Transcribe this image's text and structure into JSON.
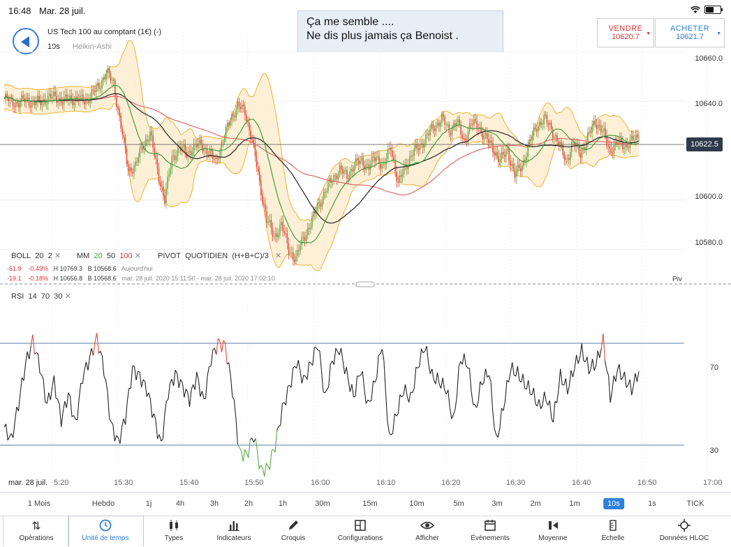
{
  "status": {
    "time": "16:48",
    "date": "Mar. 28 juil."
  },
  "header": {
    "instrument": "US Tech 100 au comptant (1€) (-)",
    "timeframe": "10s",
    "chart_type": "Heikin-Ashi"
  },
  "comment": {
    "line1": "Ça me semble ....",
    "line2": "Ne dis plus jamais ça Benoist ."
  },
  "trade": {
    "sell_label": "VENDRE",
    "sell_price": "10620.7",
    "buy_label": "ACHETER",
    "buy_price": "10621.7"
  },
  "price_axis": {
    "labels": [
      "10660.0",
      "10640.0",
      "10622.5",
      "10600.0",
      "10580.0"
    ],
    "current": "10622.5"
  },
  "indicators": {
    "boll": {
      "name": "BOLL",
      "p1": "20",
      "p2": "2"
    },
    "mm": {
      "name": "MM",
      "p1": "20",
      "p2": "50",
      "p3": "100"
    },
    "pivot": {
      "name": "PIVOT",
      "p1": "QUOTIDIEN",
      "p2": "(H+B+C)/3"
    },
    "rsi": {
      "name": "RSI",
      "p1": "14",
      "p2": "70",
      "p3": "30"
    },
    "piv_label": "Piv"
  },
  "info_rows": [
    {
      "chg": "-51.9",
      "pct": "-0.49%",
      "high": "H 10769.3",
      "low": "B 10568.6",
      "period": "Aujourd'hui"
    },
    {
      "chg": "-19.1",
      "pct": "-0.18%",
      "high": "H 10656.8",
      "low": "B 10568.6",
      "period": "mar. 28 juil. 2020 15:11:50 - mar. 28 juil. 2020 17:02:10"
    }
  ],
  "rsi_axis": {
    "upper": "70",
    "lower": "30"
  },
  "time_axis": [
    "mar. 28 juil.",
    "5:20",
    "15:30",
    "15:40",
    "15:50",
    "16:00",
    "16:10",
    "16:20",
    "16:30",
    "16:40",
    "16:50",
    "17:00"
  ],
  "timeframes": [
    "1 Mois",
    "Hebdo",
    "1j",
    "4h",
    "3h",
    "2h",
    "1h",
    "30m",
    "15m",
    "10m",
    "5m",
    "3m",
    "2m",
    "1m",
    "10s",
    "1s",
    "TICK"
  ],
  "active_timeframe": "10s",
  "nav": [
    {
      "label": "Opérations",
      "icon": "operations-icon"
    },
    {
      "label": "Unité de temps",
      "icon": "clock-icon"
    },
    {
      "label": "Types",
      "icon": "candles-icon"
    },
    {
      "label": "Indicateurs",
      "icon": "bars-icon"
    },
    {
      "label": "Croquis",
      "icon": "pencil-icon"
    },
    {
      "label": "Configurations",
      "icon": "layout-icon"
    },
    {
      "label": "Afficher",
      "icon": "eye-icon"
    },
    {
      "label": "Évènements",
      "icon": "calendar-icon"
    },
    {
      "label": "Moyenne",
      "icon": "average-icon"
    },
    {
      "label": "Échelle",
      "icon": "scale-icon"
    },
    {
      "label": "Données HLOC",
      "icon": "crosshair-icon"
    }
  ],
  "colors": {
    "up": "#5aa845",
    "down": "#e0473a",
    "band": "#f2b035",
    "band_fill": "#fdf0d6",
    "ma20": "#3f9f3f",
    "ma50": "#222222",
    "ma100": "#e06a6a",
    "rsi_line": "#222222",
    "rsi_level": "#8fa6c2",
    "accent": "#2f7fd8"
  },
  "chart_data": [
    {
      "type": "candlestick",
      "title": "US Tech 100 au comptant (1€) (-)",
      "xlabel": "",
      "ylabel": "",
      "x_ticks": [
        "5:20",
        "15:30",
        "15:40",
        "15:50",
        "16:00",
        "16:10",
        "16:20",
        "16:30",
        "16:40",
        "16:50",
        "17:00"
      ],
      "ylim": [
        10568,
        10668
      ],
      "y_ticks": [
        10580,
        10600,
        10640,
        10660
      ],
      "current_price": 10622.5,
      "close": [
        10641,
        10640,
        10639,
        10641,
        10639,
        10640,
        10641,
        10642,
        10640,
        10641,
        10641,
        10640,
        10643,
        10646,
        10652,
        10647,
        10630,
        10612,
        10614,
        10622,
        10627,
        10612,
        10600,
        10617,
        10621,
        10619,
        10621,
        10623,
        10619,
        10616,
        10624,
        10633,
        10638,
        10636,
        10624,
        10607,
        10592,
        10585,
        10590,
        10580,
        10576,
        10585,
        10590,
        10598,
        10603,
        10609,
        10612,
        10610,
        10614,
        10616,
        10613,
        10618,
        10613,
        10622,
        10606,
        10614,
        10619,
        10622,
        10626,
        10630,
        10633,
        10628,
        10632,
        10624,
        10631,
        10630,
        10625,
        10621,
        10616,
        10620,
        10610,
        10614,
        10623,
        10630,
        10633,
        10629,
        10623,
        10616,
        10623,
        10619,
        10625,
        10632,
        10628,
        10620,
        10623,
        10622,
        10624,
        10625
      ],
      "series": [
        {
          "name": "BOLL 20 2",
          "kind": "band"
        },
        {
          "name": "MM 20",
          "kind": "line"
        },
        {
          "name": "MM 50",
          "kind": "line"
        },
        {
          "name": "MM 100",
          "kind": "line"
        }
      ]
    },
    {
      "type": "line",
      "title": "RSI 14 70 30",
      "ylim": [
        13,
        87
      ],
      "levels": [
        70,
        30
      ],
      "values": [
        37,
        32,
        46,
        62,
        71,
        61,
        46,
        55,
        40,
        50,
        38,
        57,
        64,
        72,
        60,
        38,
        31,
        41,
        60,
        57,
        52,
        41,
        30,
        51,
        58,
        53,
        48,
        57,
        47,
        64,
        70,
        69,
        52,
        27,
        26,
        34,
        20,
        21,
        30,
        44,
        53,
        63,
        55,
        62,
        70,
        48,
        63,
        68,
        58,
        49,
        60,
        45,
        55,
        70,
        32,
        42,
        52,
        48,
        61,
        69,
        57,
        55,
        52,
        39,
        64,
        62,
        43,
        55,
        59,
        31,
        45,
        60,
        58,
        54,
        51,
        45,
        49,
        40,
        57,
        52,
        61,
        67,
        60,
        62,
        71,
        49,
        60,
        56,
        52,
        59
      ]
    }
  ]
}
